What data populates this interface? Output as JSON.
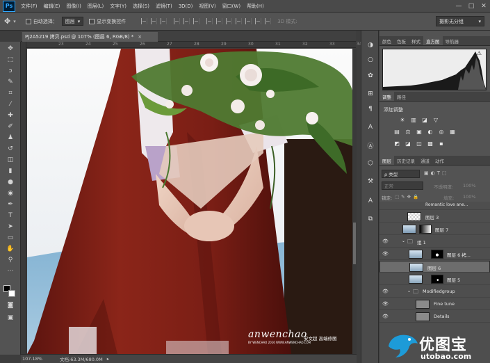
{
  "app": {
    "logo": "Ps"
  },
  "menu": [
    "文件(F)",
    "编辑(E)",
    "图像(I)",
    "图层(L)",
    "文字(Y)",
    "选择(S)",
    "滤镜(T)",
    "3D(D)",
    "视图(V)",
    "窗口(W)",
    "帮助(H)"
  ],
  "window_controls": [
    "—",
    "□",
    "✕"
  ],
  "options": {
    "auto_select_label": "自动选择：",
    "auto_select_value": "图层",
    "show_transform_label": "显示变换控件",
    "mode_3d_label": "3D 模式:",
    "workspace": "摄影无分组"
  },
  "document": {
    "tab_title": "PJ2A5219 拷贝.psd @ 107% (图层 6, RGB/8) *",
    "tab_close": "×",
    "ruler_marks": [
      "23",
      "24",
      "25",
      "26",
      "27",
      "28",
      "29",
      "30",
      "31",
      "32",
      "33",
      "34"
    ],
    "zoom": "107.18%",
    "doc_size": "文档:63.3M/680.0M",
    "status_arrow": "▸"
  },
  "watermark": {
    "script": "anwenchao",
    "caption": "安文超 高端修图",
    "url": "BY WENCHAO  2016 WWW.ANWENCHAO.COM"
  },
  "panels": {
    "top_tabs": [
      "颜色",
      "色板",
      "样式",
      "直方图",
      "导航器"
    ],
    "top_active": "直方图",
    "adj_tabs": [
      "调整",
      "路径"
    ],
    "adj_active": "调整",
    "adj_title": "添加调整",
    "adj_icons_row1": [
      "☀",
      "▥",
      "◪",
      "▽"
    ],
    "adj_icons_row2": [
      "▤",
      "⚖",
      "▣",
      "◐",
      "◎",
      "▦"
    ],
    "adj_icons_row3": [
      "◩",
      "◪",
      "◫",
      "▩",
      "▪"
    ],
    "layer_tabs": [
      "图层",
      "历史记录",
      "通道",
      "动作"
    ],
    "layer_active": "图层",
    "filter_label": "ρ 类型",
    "blend_mode": "正常",
    "opacity_label": "不透明度:",
    "opacity_value": "100%",
    "lock_label": "锁定:",
    "fill_label": "填充:",
    "fill_value": "100%",
    "layers": [
      {
        "name": "Romantic love  ane...",
        "kind": "text"
      },
      {
        "name": "图层 3",
        "kind": "pixel"
      },
      {
        "name": "图层 7",
        "kind": "masked"
      },
      {
        "name": "组 1",
        "kind": "group"
      },
      {
        "name": "图层 6 拷...",
        "kind": "masked"
      },
      {
        "name": "图层 6",
        "kind": "pixel",
        "selected": true
      },
      {
        "name": "图层 5",
        "kind": "masked"
      },
      {
        "name": "Modifiedgroup",
        "kind": "group"
      },
      {
        "name": "Fine tune",
        "kind": "pixel"
      },
      {
        "name": "Details",
        "kind": "pixel"
      }
    ]
  },
  "site_logo": {
    "text": "优图宝",
    "url": "utobao.com"
  },
  "colors": {
    "skirt": "#7a1c16",
    "ps_blue": "#31a8ff",
    "panel_bg": "#535353"
  }
}
